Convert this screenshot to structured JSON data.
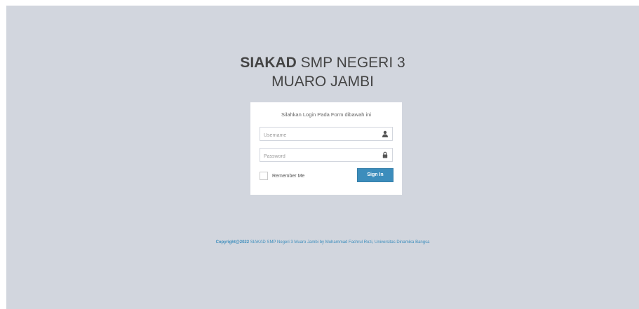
{
  "logo": {
    "bold": "SIAKAD",
    "line1_rest": " SMP NEGERI 3",
    "line2": "MUARO JAMBI"
  },
  "login": {
    "message": "Silahkan Login Pada Form dibawah ini",
    "username_placeholder": "Username",
    "username_value": "",
    "password_placeholder": "Password",
    "password_value": "",
    "remember_label": "Remember Me",
    "remember_checked": false,
    "signin_label": "Sign In"
  },
  "footer": {
    "bold": "Copyright@2022",
    "text": " SIAKAD SMP Negeri 3 Muaro Jambi by Muhammad Fachrul Rozi, Universitas Dinamika Bangsa"
  },
  "icons": {
    "username": "user-icon",
    "password": "lock-icon"
  },
  "colors": {
    "background": "#d2d6de",
    "primary": "#3c8dbc",
    "box": "#ffffff"
  }
}
